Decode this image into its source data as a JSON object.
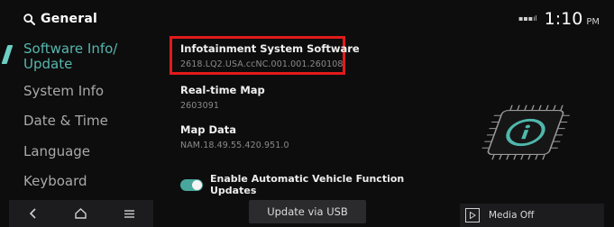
{
  "header": {
    "title": "General",
    "search_icon": "search-icon",
    "signal_text": "▪▪▪ıl",
    "time": "1:10",
    "ampm": "PM"
  },
  "sidebar": {
    "items": [
      {
        "label": "Software Info/\nUpdate",
        "active": true
      },
      {
        "label": "System Info",
        "active": false
      },
      {
        "label": "Date & Time",
        "active": false
      },
      {
        "label": "Language",
        "active": false
      },
      {
        "label": "Keyboard",
        "active": false
      }
    ],
    "accent": "#6ccfc2"
  },
  "main": {
    "items": [
      {
        "label": "Infotainment System Software",
        "value": "2618.LQ2.USA.ccNC.001.001.260108",
        "highlighted": true
      },
      {
        "label": "Real-time Map",
        "value": "2603091"
      },
      {
        "label": "Map Data",
        "value": "NAM.18.49.55.420.951.0"
      }
    ],
    "toggle": {
      "label": "Enable Automatic Vehicle Function Updates",
      "on": true
    },
    "highlight_color": "#e21a1a"
  },
  "bottom": {
    "nav": [
      "back-icon",
      "home-icon",
      "menu-icon"
    ],
    "usb_button": "Update via USB",
    "media_label": "Media Off",
    "media_icon": "play-icon"
  },
  "illustration": "info-chip-icon"
}
